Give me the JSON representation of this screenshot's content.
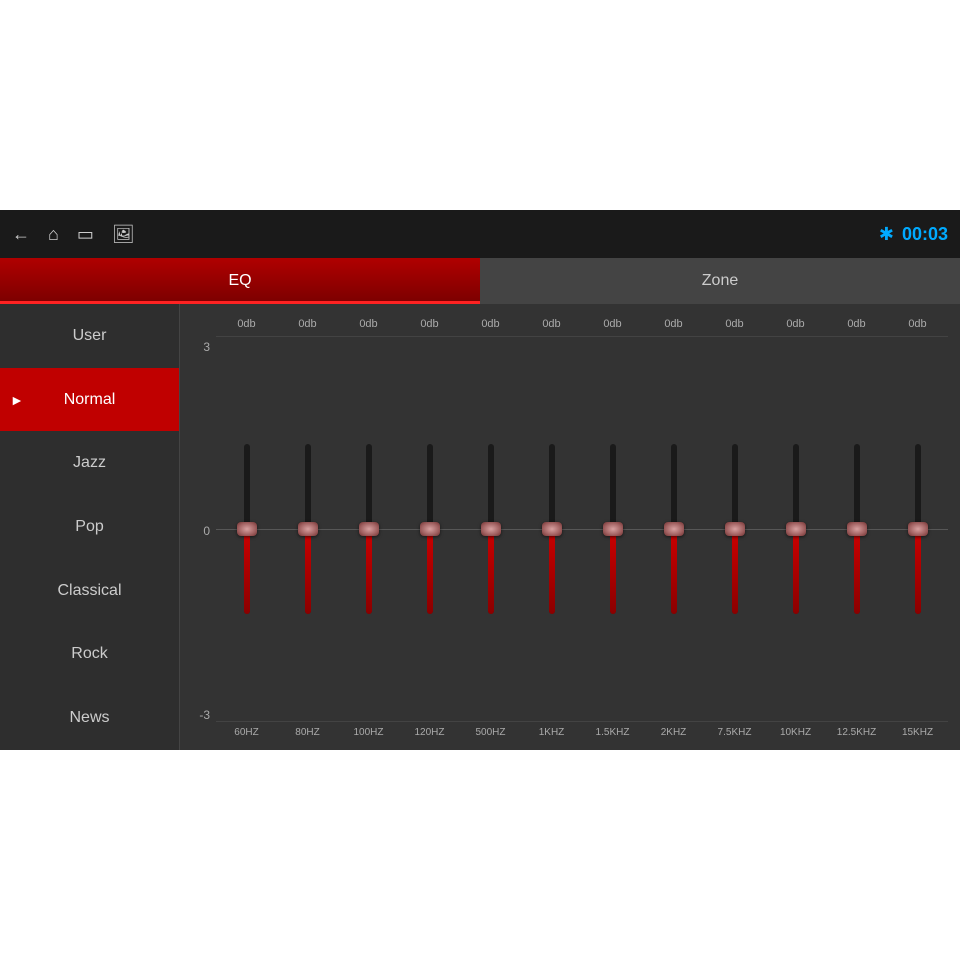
{
  "topbar": {
    "clock": "00:03",
    "icons": [
      "←",
      "⌂",
      "▭",
      "🖼"
    ]
  },
  "tabs": [
    {
      "label": "EQ",
      "id": "eq",
      "active": true
    },
    {
      "label": "Zone",
      "id": "zone",
      "active": false
    }
  ],
  "sidebar": {
    "items": [
      {
        "label": "User",
        "active": false
      },
      {
        "label": "Normal",
        "active": true
      },
      {
        "label": "Jazz",
        "active": false
      },
      {
        "label": "Pop",
        "active": false
      },
      {
        "label": "Classical",
        "active": false
      },
      {
        "label": "Rock",
        "active": false
      },
      {
        "label": "News",
        "active": false
      }
    ]
  },
  "eq": {
    "y_labels": [
      "3",
      "0",
      "-3"
    ],
    "sliders": [
      {
        "freq": "60HZ",
        "db": "0db",
        "value": 0
      },
      {
        "freq": "80HZ",
        "db": "0db",
        "value": 0
      },
      {
        "freq": "100HZ",
        "db": "0db",
        "value": 0
      },
      {
        "freq": "120HZ",
        "db": "0db",
        "value": 0
      },
      {
        "freq": "500HZ",
        "db": "0db",
        "value": 0
      },
      {
        "freq": "1KHZ",
        "db": "0db",
        "value": 0
      },
      {
        "freq": "1.5KHZ",
        "db": "0db",
        "value": 0
      },
      {
        "freq": "2KHZ",
        "db": "0db",
        "value": 0
      },
      {
        "freq": "7.5KHZ",
        "db": "0db",
        "value": 0
      },
      {
        "freq": "10KHZ",
        "db": "0db",
        "value": 0
      },
      {
        "freq": "12.5KHZ",
        "db": "0db",
        "value": 0
      },
      {
        "freq": "15KHZ",
        "db": "0db",
        "value": 0
      }
    ]
  }
}
